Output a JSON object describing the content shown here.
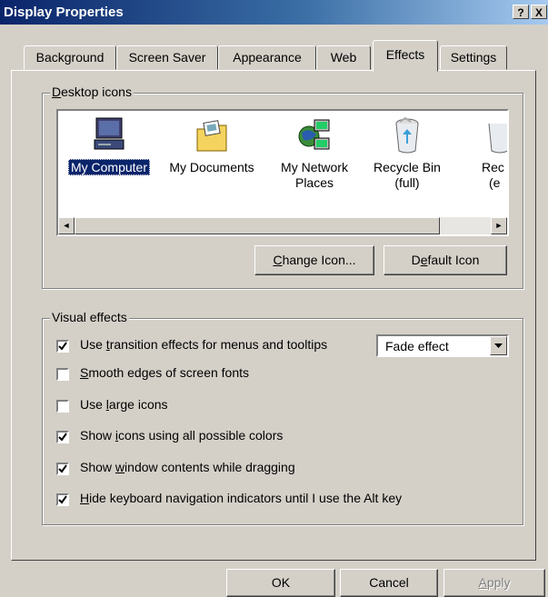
{
  "window": {
    "title": "Display Properties",
    "help_label": "?",
    "close_label": "X"
  },
  "tabs": [
    {
      "label": "Background"
    },
    {
      "label": "Screen Saver"
    },
    {
      "label": "Appearance"
    },
    {
      "label": "Web"
    },
    {
      "label": "Effects",
      "active": true
    },
    {
      "label": "Settings"
    }
  ],
  "desktop_icons": {
    "group_label_underlined": "D",
    "group_label_rest": "esktop icons",
    "items": [
      {
        "line1": "My Computer",
        "line2": "",
        "icon": "my-computer-icon",
        "selected": true
      },
      {
        "line1": "My Documents",
        "line2": "",
        "icon": "my-documents-icon"
      },
      {
        "line1": "My Network",
        "line2": "Places",
        "icon": "my-network-places-icon"
      },
      {
        "line1": "Recycle Bin",
        "line2": "(full)",
        "icon": "recycle-bin-full-icon"
      },
      {
        "line1": "Rec",
        "line2": "(e",
        "icon": "recycle-bin-empty-icon"
      }
    ],
    "scroll_left": "◄",
    "scroll_right": "►",
    "change_icon": {
      "u": "C",
      "rest": "hange Icon..."
    },
    "default_icon": {
      "pre": "D",
      "u": "e",
      "rest": "fault Icon"
    }
  },
  "visual_effects": {
    "group_label": "Visual effects",
    "options": [
      {
        "pre": "Use ",
        "u": "t",
        "rest": "ransition effects for menus and tooltips",
        "checked": true
      },
      {
        "pre": "",
        "u": "S",
        "rest": "mooth edges of screen fonts",
        "checked": false
      },
      {
        "pre": "Use ",
        "u": "l",
        "rest": "arge icons",
        "checked": false
      },
      {
        "pre": "Show ",
        "u": "i",
        "rest": "cons using all possible colors",
        "checked": true
      },
      {
        "pre": "Show ",
        "u": "w",
        "rest": "indow contents while dragging",
        "checked": true
      },
      {
        "pre": "",
        "u": "H",
        "rest": "ide keyboard navigation indicators until I use the Alt key",
        "checked": true
      }
    ],
    "transition_select": "Fade effect"
  },
  "footer": {
    "ok": "OK",
    "cancel": "Cancel",
    "apply": {
      "u": "A",
      "rest": "pply"
    }
  }
}
